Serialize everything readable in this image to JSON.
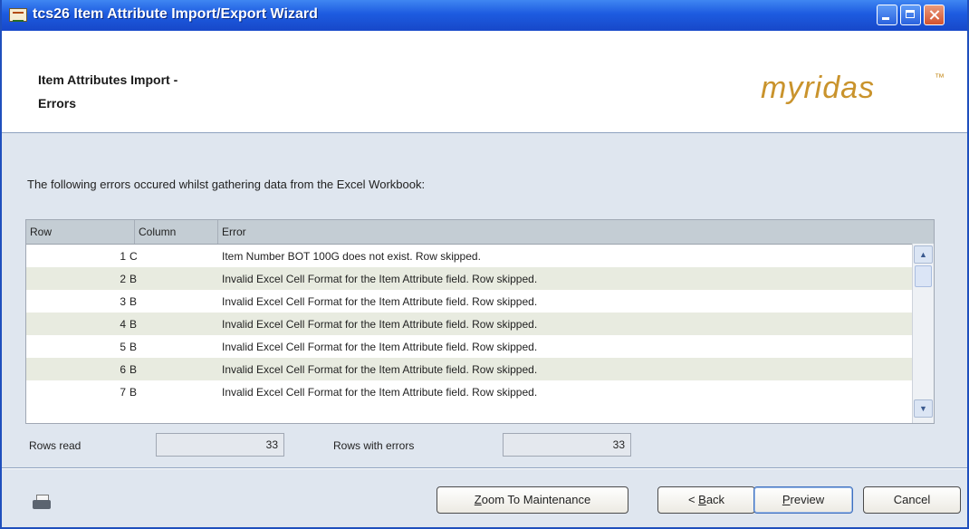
{
  "window": {
    "title": "tcs26 Item Attribute Import/Export Wizard",
    "controls": [
      "minimize",
      "maximize",
      "close"
    ]
  },
  "header": {
    "line1": "Item Attributes Import -",
    "line2": "Errors",
    "logo": "myridas",
    "logo_tm": "™",
    "logo_color": "#c9932c"
  },
  "intro_text": "The following errors occured whilst gathering data from the Excel Workbook:",
  "grid": {
    "columns": [
      "Row",
      "Column",
      "Error"
    ],
    "rows": [
      {
        "row": "1",
        "column": "C",
        "error": "Item Number BOT 100G does not exist. Row skipped."
      },
      {
        "row": "2",
        "column": "B",
        "error": "Invalid Excel Cell Format for the Item Attribute field. Row skipped."
      },
      {
        "row": "3",
        "column": "B",
        "error": "Invalid Excel Cell Format for the Item Attribute field. Row skipped."
      },
      {
        "row": "4",
        "column": "B",
        "error": "Invalid Excel Cell Format for the Item Attribute field. Row skipped."
      },
      {
        "row": "5",
        "column": "B",
        "error": "Invalid Excel Cell Format for the Item Attribute field. Row skipped."
      },
      {
        "row": "6",
        "column": "B",
        "error": "Invalid Excel Cell Format for the Item Attribute field. Row skipped."
      },
      {
        "row": "7",
        "column": "B",
        "error": "Invalid Excel Cell Format for the Item Attribute field. Row skipped."
      }
    ]
  },
  "stats": {
    "rows_read_label": "Rows read",
    "rows_read_value": "33",
    "rows_errors_label": "Rows with errors",
    "rows_errors_value": "33"
  },
  "buttons": {
    "zoom_mn": "Z",
    "zoom_rest": "oom To Maintenance",
    "back_pre": "< ",
    "back_mn": "B",
    "back_rest": "ack",
    "preview_mn": "P",
    "preview_rest": "review",
    "cancel": "Cancel"
  },
  "icons": {
    "window_icon": "app-icon",
    "print_icon": "printer-icon",
    "scroll_up": "chevron-up-icon",
    "scroll_down": "chevron-down-icon"
  }
}
